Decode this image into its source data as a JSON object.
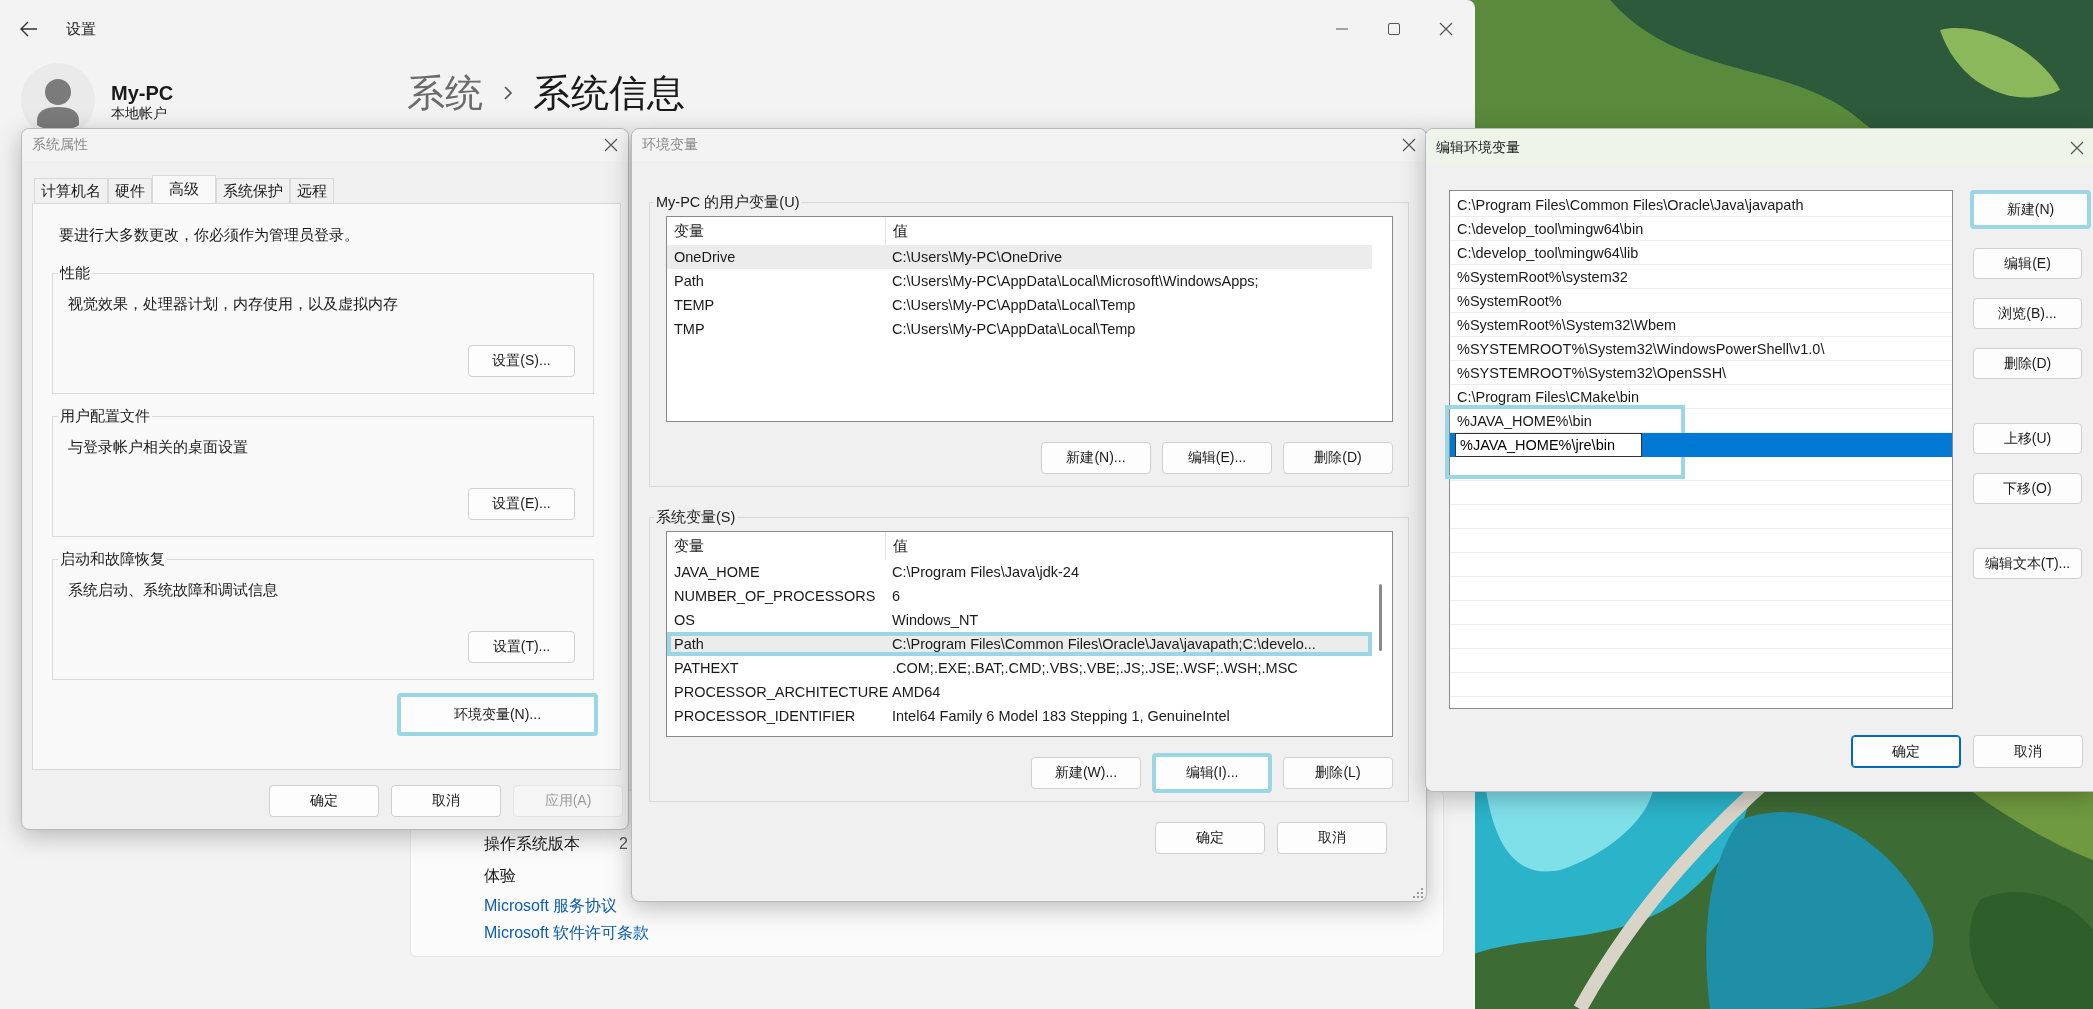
{
  "settings": {
    "title": "设置",
    "account": {
      "name": "My-PC",
      "type": "本地帐户"
    },
    "breadcrumb": {
      "parent": "系统",
      "current": "系统信息"
    },
    "info_rows": [
      {
        "label": "操作系统版本",
        "value": "2"
      },
      {
        "label": "体验"
      }
    ],
    "links": [
      "Microsoft 服务协议",
      "Microsoft 软件许可条款"
    ]
  },
  "system_properties": {
    "title": "系统属性",
    "tabs": [
      {
        "label": "计算机名",
        "selected": false
      },
      {
        "label": "硬件",
        "selected": false
      },
      {
        "label": "高级",
        "selected": true
      },
      {
        "label": "系统保护",
        "selected": false
      },
      {
        "label": "远程",
        "selected": false
      }
    ],
    "notice": "要进行大多数更改，你必须作为管理员登录。",
    "groups": [
      {
        "title": "性能",
        "description": "视觉效果，处理器计划，内存使用，以及虚拟内存",
        "button": "设置(S)..."
      },
      {
        "title": "用户配置文件",
        "description": "与登录帐户相关的桌面设置",
        "button": "设置(E)..."
      },
      {
        "title": "启动和故障恢复",
        "description": "系统启动、系统故障和调试信息",
        "button": "设置(T)..."
      }
    ],
    "env_button": {
      "label": "环境变量(N)...",
      "highlighted": true
    },
    "buttons": [
      {
        "label": "确定",
        "disabled": false
      },
      {
        "label": "取消",
        "disabled": false
      },
      {
        "label": "应用(A)",
        "disabled": true
      }
    ]
  },
  "environment_variables": {
    "title": "环境变量",
    "user_variables": {
      "title": "My-PC 的用户变量(U)",
      "columns": [
        "变量",
        "值"
      ],
      "rows": [
        {
          "name": "OneDrive",
          "value": "C:\\Users\\My-PC\\OneDrive",
          "selected": true,
          "highlighted": false
        },
        {
          "name": "Path",
          "value": "C:\\Users\\My-PC\\AppData\\Local\\Microsoft\\WindowsApps;",
          "selected": false,
          "highlighted": false
        },
        {
          "name": "TEMP",
          "value": "C:\\Users\\My-PC\\AppData\\Local\\Temp",
          "selected": false,
          "highlighted": false
        },
        {
          "name": "TMP",
          "value": "C:\\Users\\My-PC\\AppData\\Local\\Temp",
          "selected": false,
          "highlighted": false
        }
      ],
      "buttons": [
        {
          "label": "新建(N)...",
          "highlighted": false
        },
        {
          "label": "编辑(E)...",
          "highlighted": false
        },
        {
          "label": "删除(D)",
          "highlighted": false
        }
      ]
    },
    "system_variables": {
      "title": "系统变量(S)",
      "columns": [
        "变量",
        "值"
      ],
      "rows": [
        {
          "name": "JAVA_HOME",
          "value": "C:\\Program Files\\Java\\jdk-24",
          "selected": false,
          "highlighted": false
        },
        {
          "name": "NUMBER_OF_PROCESSORS",
          "value": "6",
          "selected": false,
          "highlighted": false
        },
        {
          "name": "OS",
          "value": "Windows_NT",
          "selected": false,
          "highlighted": false
        },
        {
          "name": "Path",
          "value": "C:\\Program Files\\Common Files\\Oracle\\Java\\javapath;C:\\develo...",
          "selected": true,
          "highlighted": true
        },
        {
          "name": "PATHEXT",
          "value": ".COM;.EXE;.BAT;.CMD;.VBS;.VBE;.JS;.JSE;.WSF;.WSH;.MSC",
          "selected": false,
          "highlighted": false
        },
        {
          "name": "PROCESSOR_ARCHITECTURE",
          "value": "AMD64",
          "selected": false,
          "highlighted": false
        },
        {
          "name": "PROCESSOR_IDENTIFIER",
          "value": "Intel64 Family 6 Model 183 Stepping 1, GenuineIntel",
          "selected": false,
          "highlighted": false
        }
      ],
      "buttons": [
        {
          "label": "新建(W)...",
          "highlighted": false
        },
        {
          "label": "编辑(I)...",
          "highlighted": true
        },
        {
          "label": "删除(L)",
          "highlighted": false
        }
      ]
    },
    "buttons": [
      "确定",
      "取消"
    ]
  },
  "edit_variable": {
    "title": "编辑环境变量",
    "entries": [
      {
        "text": "C:\\Program Files\\Common Files\\Oracle\\Java\\javapath",
        "selected": false,
        "editing": false,
        "highlighted": false
      },
      {
        "text": "C:\\develop_tool\\mingw64\\bin",
        "selected": false,
        "editing": false,
        "highlighted": false
      },
      {
        "text": "C:\\develop_tool\\mingw64\\lib",
        "selected": false,
        "editing": false,
        "highlighted": false
      },
      {
        "text": "%SystemRoot%\\system32",
        "selected": false,
        "editing": false,
        "highlighted": false
      },
      {
        "text": "%SystemRoot%",
        "selected": false,
        "editing": false,
        "highlighted": false
      },
      {
        "text": "%SystemRoot%\\System32\\Wbem",
        "selected": false,
        "editing": false,
        "highlighted": false
      },
      {
        "text": "%SYSTEMROOT%\\System32\\WindowsPowerShell\\v1.0\\",
        "selected": false,
        "editing": false,
        "highlighted": false
      },
      {
        "text": "%SYSTEMROOT%\\System32\\OpenSSH\\",
        "selected": false,
        "editing": false,
        "highlighted": false
      },
      {
        "text": "C:\\Program Files\\CMake\\bin",
        "selected": false,
        "editing": false,
        "highlighted": false
      },
      {
        "text": "%JAVA_HOME%\\bin",
        "selected": false,
        "editing": false,
        "highlighted": true
      },
      {
        "text": "%JAVA_HOME%\\jre\\bin",
        "selected": true,
        "editing": true,
        "highlighted": true
      }
    ],
    "buttons": [
      {
        "label": "新建(N)",
        "highlighted": true
      },
      {
        "label": "编辑(E)",
        "highlighted": false
      },
      {
        "label": "浏览(B)...",
        "highlighted": false
      },
      {
        "label": "删除(D)",
        "highlighted": false
      },
      {
        "label": "上移(U)",
        "highlighted": false
      },
      {
        "label": "下移(O)",
        "highlighted": false
      },
      {
        "label": "编辑文本(T)...",
        "highlighted": false
      }
    ],
    "footer": [
      {
        "label": "确定",
        "default": true
      },
      {
        "label": "取消",
        "default": false
      }
    ]
  }
}
